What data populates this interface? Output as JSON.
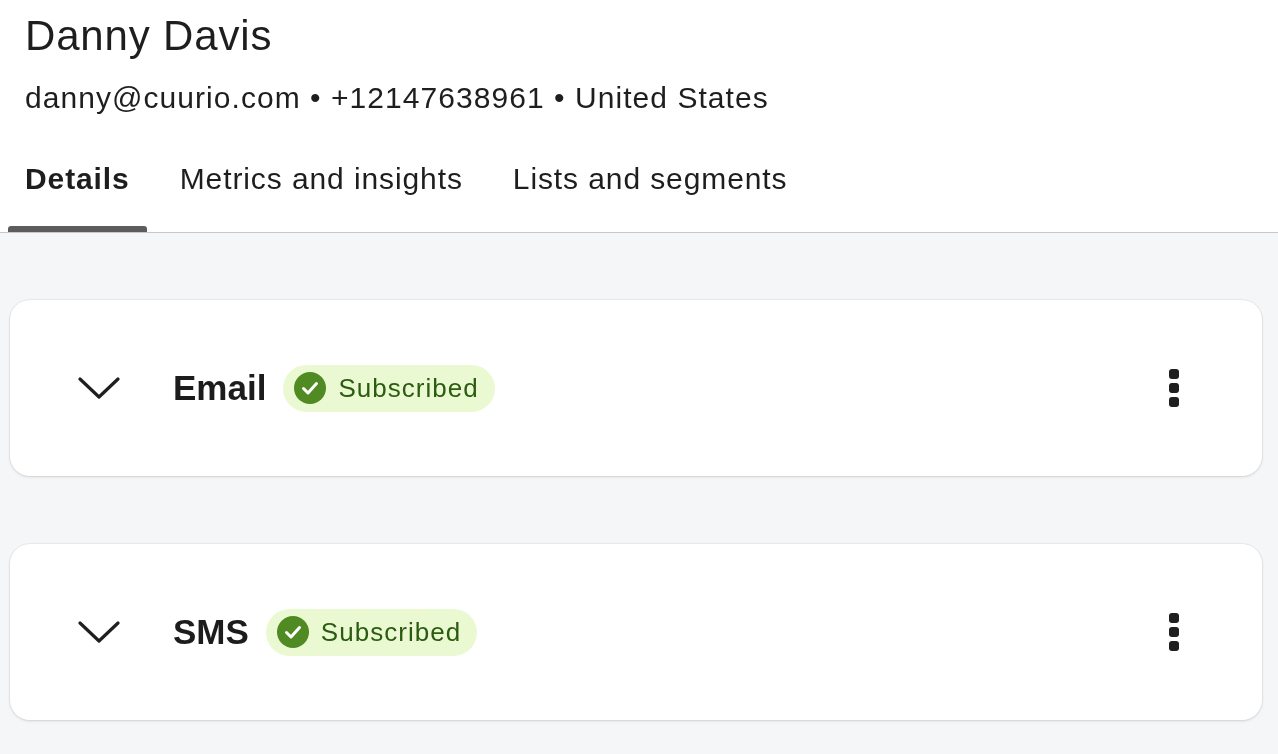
{
  "contact": {
    "name": "Danny Davis",
    "details": "danny@cuurio.com • +12147638961 • United States"
  },
  "tabs": [
    {
      "label": "Details",
      "selected": true
    },
    {
      "label": "Metrics and insights",
      "selected": false
    },
    {
      "label": "Lists and segments",
      "selected": false
    }
  ],
  "channels": [
    {
      "name": "Email",
      "expanded": false,
      "status": {
        "kind": "subscribed",
        "label": "Subscribed"
      }
    },
    {
      "name": "SMS",
      "expanded": false,
      "status": {
        "kind": "subscribed",
        "label": "Subscribed"
      }
    }
  ]
}
